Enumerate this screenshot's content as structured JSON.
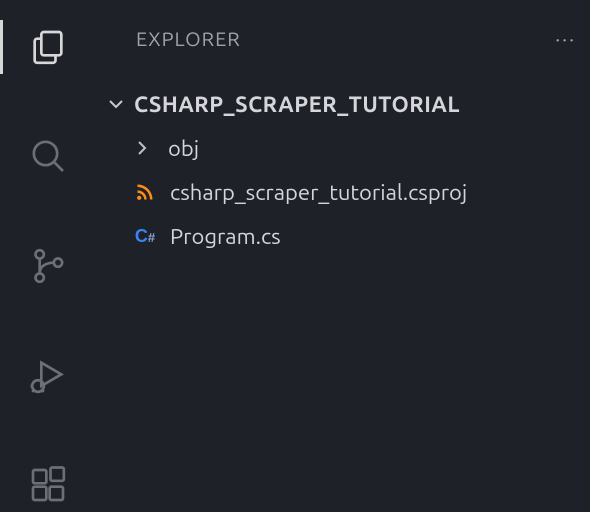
{
  "panel": {
    "title": "EXPLORER"
  },
  "tree": {
    "root_name": "CSHARP_SCRAPER_TUTORIAL",
    "children": {
      "folder1": "obj",
      "file1": "csharp_scraper_tutorial.csproj",
      "file2": "Program.cs"
    }
  }
}
